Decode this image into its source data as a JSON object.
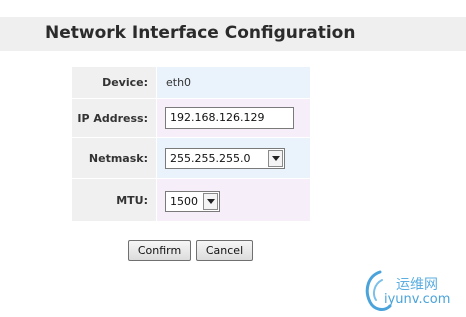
{
  "page": {
    "title": "Network Interface Configuration"
  },
  "form": {
    "device": {
      "label": "Device:",
      "value": "eth0"
    },
    "ip_address": {
      "label": "IP Address:",
      "value": "192.168.126.129"
    },
    "netmask": {
      "label": "Netmask:",
      "selected": "255.255.255.0"
    },
    "mtu": {
      "label": "MTU:",
      "selected": "1500"
    }
  },
  "buttons": {
    "confirm": "Confirm",
    "cancel": "Cancel"
  },
  "watermark": {
    "line1": "运维网",
    "line2": "iyunv.com"
  },
  "colors": {
    "header_bg": "#efefef",
    "label_bg": "#f0f0f0",
    "row_blue": "#eaf3fb",
    "row_pink": "#f6eef8",
    "watermark": "#5aaee0"
  },
  "icons": {
    "dropdown": "chevron-down-icon",
    "watermark_logo": "swirl-logo-icon"
  }
}
